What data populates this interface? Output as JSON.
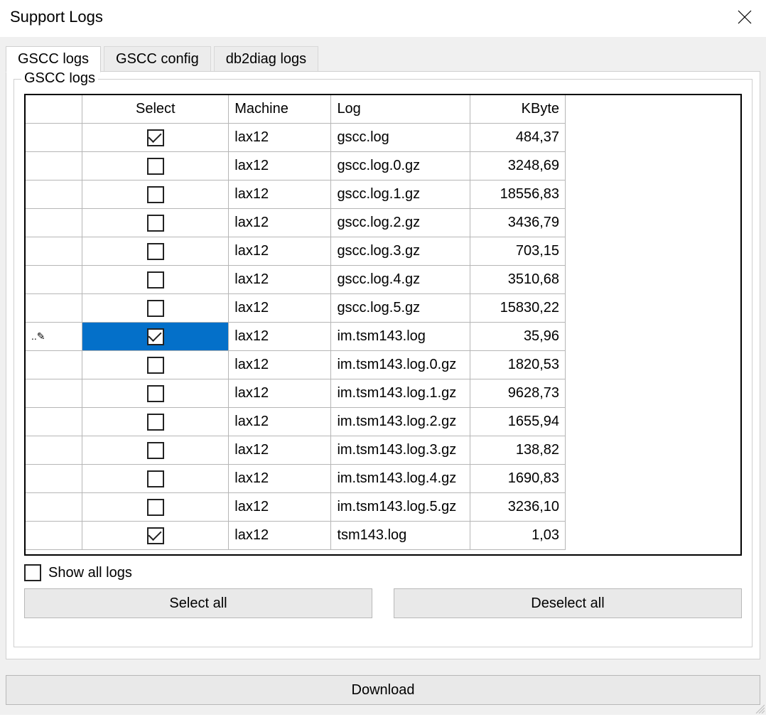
{
  "window": {
    "title": "Support Logs"
  },
  "tabs": {
    "items": [
      {
        "label": "GSCC logs",
        "active": true
      },
      {
        "label": "GSCC config",
        "active": false
      },
      {
        "label": "db2diag logs",
        "active": false
      }
    ]
  },
  "group": {
    "label": "GSCC logs"
  },
  "grid": {
    "columns": {
      "select": "Select",
      "machine": "Machine",
      "log": "Log",
      "kbyte": "KByte"
    },
    "editing_row_index": 7,
    "rows": [
      {
        "selected": true,
        "machine": "lax12",
        "log": "gscc.log",
        "kbyte": "484,37"
      },
      {
        "selected": false,
        "machine": "lax12",
        "log": "gscc.log.0.gz",
        "kbyte": "3248,69"
      },
      {
        "selected": false,
        "machine": "lax12",
        "log": "gscc.log.1.gz",
        "kbyte": "18556,83"
      },
      {
        "selected": false,
        "machine": "lax12",
        "log": "gscc.log.2.gz",
        "kbyte": "3436,79"
      },
      {
        "selected": false,
        "machine": "lax12",
        "log": "gscc.log.3.gz",
        "kbyte": "703,15"
      },
      {
        "selected": false,
        "machine": "lax12",
        "log": "gscc.log.4.gz",
        "kbyte": "3510,68"
      },
      {
        "selected": false,
        "machine": "lax12",
        "log": "gscc.log.5.gz",
        "kbyte": "15830,22"
      },
      {
        "selected": true,
        "machine": "lax12",
        "log": "im.tsm143.log",
        "kbyte": "35,96"
      },
      {
        "selected": false,
        "machine": "lax12",
        "log": "im.tsm143.log.0.gz",
        "kbyte": "1820,53"
      },
      {
        "selected": false,
        "machine": "lax12",
        "log": "im.tsm143.log.1.gz",
        "kbyte": "9628,73"
      },
      {
        "selected": false,
        "machine": "lax12",
        "log": "im.tsm143.log.2.gz",
        "kbyte": "1655,94"
      },
      {
        "selected": false,
        "machine": "lax12",
        "log": "im.tsm143.log.3.gz",
        "kbyte": "138,82"
      },
      {
        "selected": false,
        "machine": "lax12",
        "log": "im.tsm143.log.4.gz",
        "kbyte": "1690,83"
      },
      {
        "selected": false,
        "machine": "lax12",
        "log": "im.tsm143.log.5.gz",
        "kbyte": "3236,10"
      },
      {
        "selected": true,
        "machine": "lax12",
        "log": "tsm143.log",
        "kbyte": "1,03"
      }
    ]
  },
  "show_all": {
    "label": "Show all logs",
    "checked": false
  },
  "buttons": {
    "select_all": "Select all",
    "deselect_all": "Deselect all",
    "download": "Download"
  },
  "row_edit_glyph": "..✎"
}
